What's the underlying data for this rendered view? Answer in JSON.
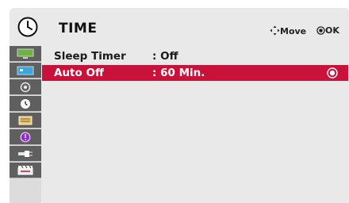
{
  "header": {
    "title": "TIME",
    "move_hint": "Move",
    "ok_hint": "OK"
  },
  "sidebar": {
    "items": [
      {
        "icon": "picture-icon"
      },
      {
        "icon": "screen-icon"
      },
      {
        "icon": "audio-icon"
      },
      {
        "icon": "time-icon",
        "selected": true
      },
      {
        "icon": "option-icon"
      },
      {
        "icon": "info-icon"
      },
      {
        "icon": "input-icon"
      },
      {
        "icon": "movie-icon"
      }
    ]
  },
  "menu": {
    "rows": [
      {
        "label": "Sleep Timer",
        "value": ": Off"
      },
      {
        "label": "Auto Off",
        "value": ": 60 Min.",
        "selected": true
      }
    ]
  },
  "colors": {
    "highlight": "#c8123a",
    "sidebar": "#5f5f5f",
    "panel": "#e9e9e9"
  }
}
